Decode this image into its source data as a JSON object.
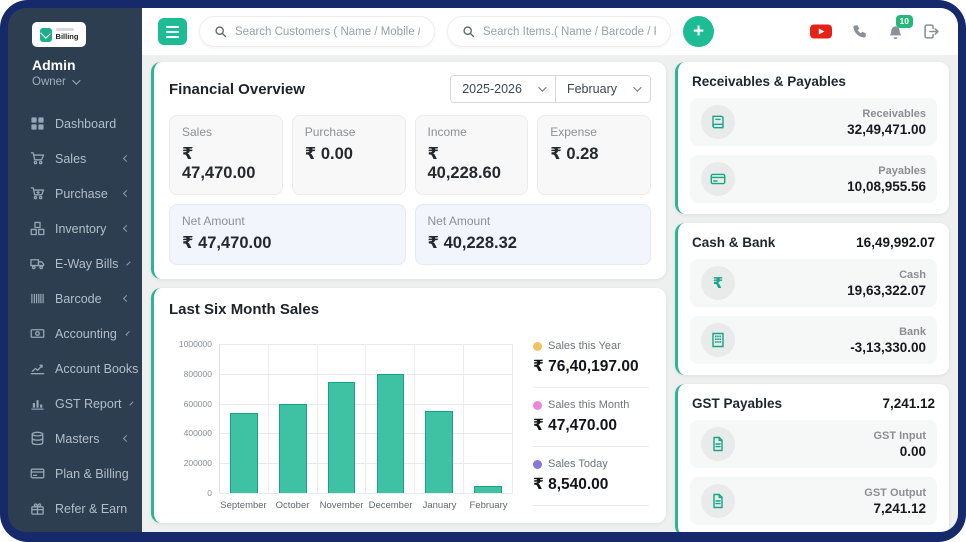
{
  "brand": {
    "logo_label": "Billing",
    "user_name": "Admin",
    "user_role": "Owner"
  },
  "sidebar": {
    "items": [
      {
        "label": "Dashboard",
        "icon": "dashboard-grid",
        "submenu": false
      },
      {
        "label": "Sales",
        "icon": "sales-cart",
        "submenu": true
      },
      {
        "label": "Purchase",
        "icon": "purchase-cart",
        "submenu": true
      },
      {
        "label": "Inventory",
        "icon": "inventory-cubes",
        "submenu": true
      },
      {
        "label": "E-Way Bills",
        "icon": "truck",
        "submenu": true
      },
      {
        "label": "Barcode",
        "icon": "barcode",
        "submenu": true
      },
      {
        "label": "Accounting",
        "icon": "money-note",
        "submenu": true
      },
      {
        "label": "Account Books",
        "icon": "chart-line",
        "submenu": true
      },
      {
        "label": "GST Report",
        "icon": "bar-chart",
        "submenu": true
      },
      {
        "label": "Masters",
        "icon": "database",
        "submenu": true
      },
      {
        "label": "Plan & Billing",
        "icon": "credit-card",
        "submenu": false
      },
      {
        "label": "Refer & Earn",
        "icon": "gift",
        "submenu": false
      }
    ]
  },
  "topbar": {
    "search_customers_placeholder": "Search Customers ( Name / Mobile / GSTIN",
    "search_items_placeholder": "Search Items.( Name / Barcode / Part No )",
    "notification_count": "10",
    "icons": [
      "hamburger",
      "search",
      "add-plus",
      "youtube",
      "phone",
      "bell-notifications",
      "sign-out"
    ]
  },
  "financial_overview": {
    "title": "Financial Overview",
    "year": "2025-2026",
    "month": "February",
    "stats": [
      {
        "label": "Sales",
        "value": "₹ 47,470.00"
      },
      {
        "label": "Purchase",
        "value": "₹ 0.00"
      },
      {
        "label": "Income",
        "value": "₹ 40,228.60"
      },
      {
        "label": "Expense",
        "value": "₹ 0.28"
      }
    ],
    "net_stats": [
      {
        "label": "Net Amount",
        "value": "₹ 47,470.00"
      },
      {
        "label": "Net Amount",
        "value": "₹ 40,228.32"
      }
    ]
  },
  "chart_data": {
    "type": "bar",
    "title": "Last Six Month Sales",
    "categories": [
      "September",
      "October",
      "November",
      "December",
      "January",
      "February"
    ],
    "values": [
      535000,
      597000,
      748000,
      800000,
      551000,
      47470
    ],
    "xlabel": "",
    "ylabel": "",
    "ylim": [
      0,
      1000000
    ],
    "yticks": [
      0,
      200000,
      400000,
      600000,
      800000,
      1000000
    ],
    "grid": true,
    "bar_color": "#3ec2a3",
    "bar_border": "#17a287",
    "legend_position": "right",
    "summary": [
      {
        "label": "Sales this Year",
        "value": "₹ 76,40,197.00",
        "dot_color": "#f2c160"
      },
      {
        "label": "Sales this Month",
        "value": "₹ 47,470.00",
        "dot_color": "#ea87d8"
      },
      {
        "label": "Sales Today",
        "value": "₹ 8,540.00",
        "dot_color": "#8677d9"
      }
    ]
  },
  "right_cards": [
    {
      "title": "Receivables & Payables",
      "total": "",
      "rows": [
        {
          "icon": "ledger-book",
          "label": "Receivables",
          "value": "32,49,471.00"
        },
        {
          "icon": "credit-card",
          "label": "Payables",
          "value": "10,08,955.56"
        }
      ]
    },
    {
      "title": "Cash & Bank",
      "total": "16,49,992.07",
      "rows": [
        {
          "icon": "rupee",
          "label": "Cash",
          "value": "19,63,322.07"
        },
        {
          "icon": "bank-building",
          "label": "Bank",
          "value": "-3,13,330.00"
        }
      ]
    },
    {
      "title": "GST Payables",
      "total": "7,241.12",
      "rows": [
        {
          "icon": "document",
          "label": "GST Input",
          "value": "0.00"
        },
        {
          "icon": "document",
          "label": "GST Output",
          "value": "7,241.12"
        }
      ]
    }
  ],
  "colors": {
    "frame": "#16296b",
    "sidebar_bg": "#2d3e50",
    "accent_green": "#1ebc94",
    "card_accent": "#2eb398",
    "badge_green": "#26b77c",
    "youtube_red": "#e62117"
  }
}
